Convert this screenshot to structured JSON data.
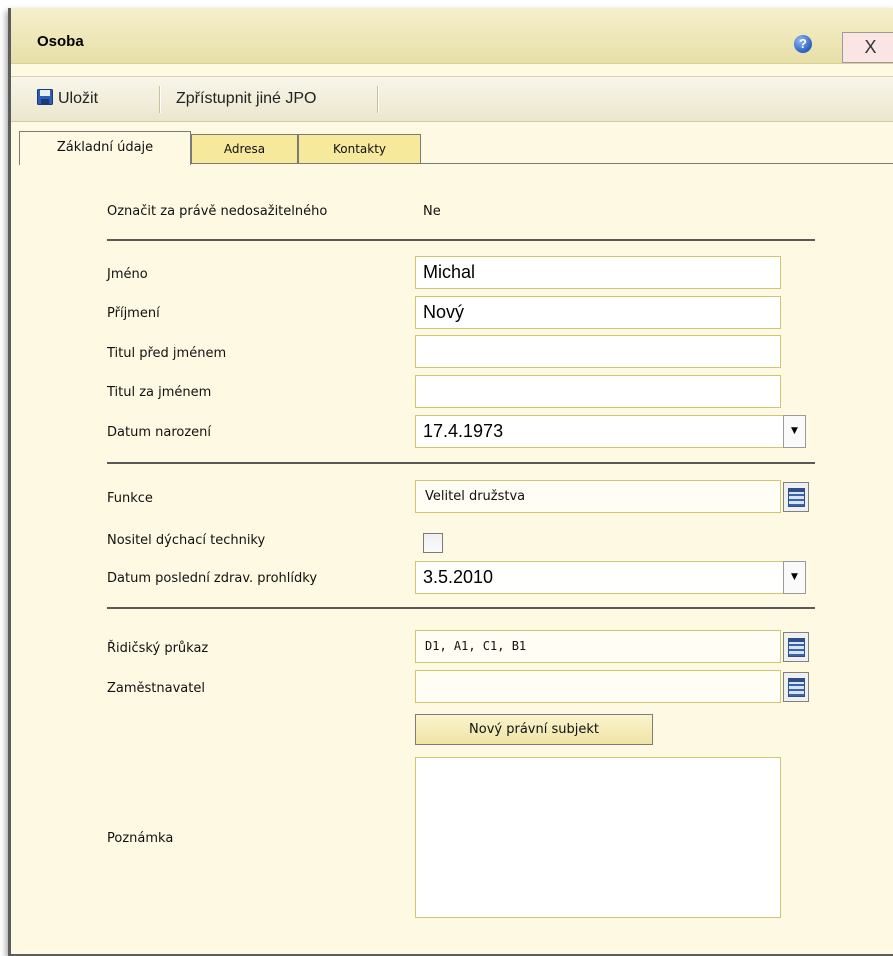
{
  "window": {
    "title": "Osoba",
    "help_glyph": "?",
    "close_label": "X"
  },
  "toolbar": {
    "save_label": "Uložit",
    "share_label": "Zpřístupnit jiné JPO"
  },
  "tabs": [
    {
      "label": "Základní údaje",
      "active": true
    },
    {
      "label": "Adresa",
      "active": false
    },
    {
      "label": "Kontakty",
      "active": false
    }
  ],
  "form": {
    "unreachable": {
      "label": "Označit za právě nedosažitelného",
      "value": "Ne"
    },
    "first_name": {
      "label": "Jméno",
      "value": "Michal"
    },
    "last_name": {
      "label": "Příjmení",
      "value": "Nový"
    },
    "title_before": {
      "label": "Titul před jménem",
      "value": ""
    },
    "title_after": {
      "label": "Titul za jménem",
      "value": ""
    },
    "birth_date": {
      "label": "Datum narození",
      "value": "17.4.1973"
    },
    "function": {
      "label": "Funkce",
      "value": "Velitel družstva"
    },
    "breathing_apparatus": {
      "label": "Nositel dýchací techniky",
      "checked": false
    },
    "last_medical": {
      "label": "Datum poslední zdrav. prohlídky",
      "value": "3.5.2010"
    },
    "driving_license": {
      "label": "Řidičský průkaz",
      "value": "D1, A1, C1, B1"
    },
    "employer": {
      "label": "Zaměstnavatel",
      "value": ""
    },
    "new_subject_button": "Nový právní subjekt",
    "note": {
      "label": "Poznámka",
      "value": ""
    }
  },
  "icons": {
    "help": "help-icon",
    "close": "close-icon",
    "save": "floppy-disk-icon",
    "picker": "list-picker-icon",
    "dropdown": "dropdown-arrow-icon"
  }
}
